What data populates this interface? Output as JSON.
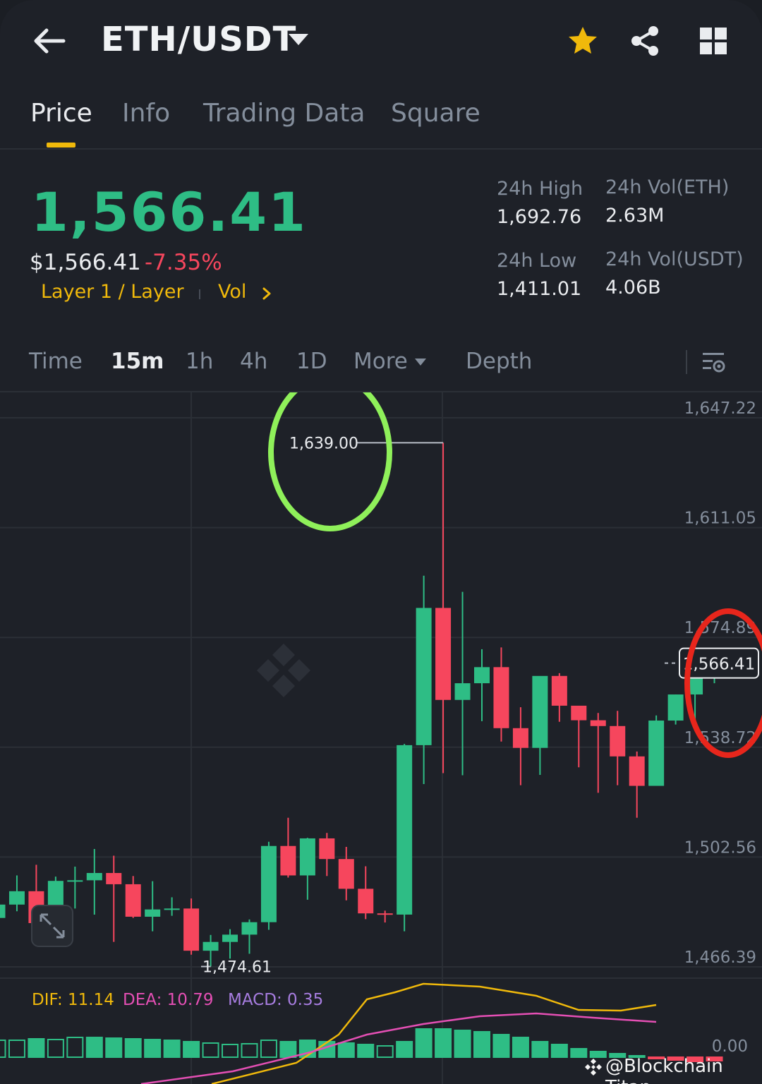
{
  "header": {
    "pair": "ETH/USDT",
    "icons": [
      "back-arrow-icon",
      "caret-down-icon",
      "star-icon",
      "share-icon",
      "grid-icon"
    ],
    "star_color": "#f0b90b"
  },
  "tabs": [
    {
      "label": "Price",
      "active": true
    },
    {
      "label": "Info",
      "active": false
    },
    {
      "label": "Trading Data",
      "active": false
    },
    {
      "label": "Square",
      "active": false
    }
  ],
  "summary": {
    "last_price": "1,566.41",
    "fiat_price": "$1,566.41",
    "change_pct": "-7.35%",
    "tags": [
      "Layer 1 / Layer",
      "Vol"
    ],
    "stats": {
      "high_label": "24h High",
      "high_value": "1,692.76",
      "low_label": "24h Low",
      "low_value": "1,411.01",
      "vol_eth_label": "24h Vol(ETH)",
      "vol_eth_value": "2.63M",
      "vol_usdt_label": "24h Vol(USDT)",
      "vol_usdt_value": "4.06B"
    }
  },
  "intervals": [
    {
      "label": "Time",
      "active": false
    },
    {
      "label": "15m",
      "active": true
    },
    {
      "label": "1h",
      "active": false
    },
    {
      "label": "4h",
      "active": false
    },
    {
      "label": "1D",
      "active": false
    },
    {
      "label": "More",
      "active": false
    },
    {
      "label": "Depth",
      "active": false
    }
  ],
  "colors": {
    "up": "#2ebd85",
    "down": "#f6465d",
    "accent": "#f0b90b",
    "annotation_green": "#8ff05a",
    "annotation_red": "#e8261c"
  },
  "chart_data": {
    "type": "candlestick",
    "y_ticks": [
      "1,647.22",
      "1,611.05",
      "1,574.89",
      "1,538.72",
      "1,502.56",
      "1,466.39"
    ],
    "ylim": [
      1466.39,
      1647.22
    ],
    "high_marker": "1,639.00",
    "low_marker": "1,474.61",
    "last_price_tag": "1,566.41",
    "candles": [
      {
        "o": 1482.5,
        "h": 1490.0,
        "l": 1477.8,
        "c": 1486.9
      },
      {
        "o": 1486.9,
        "h": 1496.5,
        "l": 1484.7,
        "c": 1491.3
      },
      {
        "o": 1491.3,
        "h": 1500.0,
        "l": 1477.1,
        "c": 1480.8
      },
      {
        "o": 1480.8,
        "h": 1496.1,
        "l": 1476.9,
        "c": 1494.7
      },
      {
        "o": 1494.7,
        "h": 1499.4,
        "l": 1485.6,
        "c": 1494.9
      },
      {
        "o": 1494.9,
        "h": 1505.2,
        "l": 1483.6,
        "c": 1497.3
      },
      {
        "o": 1497.3,
        "h": 1503.0,
        "l": 1474.6,
        "c": 1493.6
      },
      {
        "o": 1493.6,
        "h": 1496.3,
        "l": 1482.5,
        "c": 1482.9
      },
      {
        "o": 1482.9,
        "h": 1494.6,
        "l": 1478.1,
        "c": 1485.3
      },
      {
        "o": 1485.3,
        "h": 1489.3,
        "l": 1483.2,
        "c": 1485.6
      },
      {
        "o": 1485.6,
        "h": 1488.9,
        "l": 1470.4,
        "c": 1471.7
      },
      {
        "o": 1471.7,
        "h": 1476.9,
        "l": 1466.5,
        "c": 1474.6
      },
      {
        "o": 1474.6,
        "h": 1478.8,
        "l": 1469.1,
        "c": 1477.0
      },
      {
        "o": 1477.0,
        "h": 1482.0,
        "l": 1470.7,
        "c": 1481.1
      },
      {
        "o": 1481.1,
        "h": 1507.6,
        "l": 1478.6,
        "c": 1506.2
      },
      {
        "o": 1506.2,
        "h": 1515.5,
        "l": 1495.8,
        "c": 1496.5
      },
      {
        "o": 1496.5,
        "h": 1508.9,
        "l": 1488.5,
        "c": 1508.7
      },
      {
        "o": 1508.7,
        "h": 1510.5,
        "l": 1496.3,
        "c": 1501.9
      },
      {
        "o": 1501.9,
        "h": 1505.9,
        "l": 1488.3,
        "c": 1492.1
      },
      {
        "o": 1492.1,
        "h": 1499.5,
        "l": 1482.1,
        "c": 1484.0
      },
      {
        "o": 1484.0,
        "h": 1484.9,
        "l": 1481.0,
        "c": 1483.6
      },
      {
        "o": 1483.6,
        "h": 1539.8,
        "l": 1478.1,
        "c": 1539.4
      },
      {
        "o": 1539.4,
        "h": 1595.2,
        "l": 1526.6,
        "c": 1584.6
      },
      {
        "o": 1584.6,
        "h": 1639.0,
        "l": 1530.2,
        "c": 1554.3
      },
      {
        "o": 1554.3,
        "h": 1589.9,
        "l": 1529.5,
        "c": 1559.8
      },
      {
        "o": 1559.8,
        "h": 1571.0,
        "l": 1547.3,
        "c": 1565.1
      },
      {
        "o": 1565.1,
        "h": 1571.6,
        "l": 1540.6,
        "c": 1545.0
      },
      {
        "o": 1545.0,
        "h": 1551.9,
        "l": 1526.2,
        "c": 1538.5
      },
      {
        "o": 1538.5,
        "h": 1562.0,
        "l": 1529.6,
        "c": 1562.2
      },
      {
        "o": 1562.2,
        "h": 1563.1,
        "l": 1547.1,
        "c": 1552.4
      },
      {
        "o": 1552.4,
        "h": 1552.4,
        "l": 1532.1,
        "c": 1547.6
      },
      {
        "o": 1547.6,
        "h": 1550.0,
        "l": 1523.7,
        "c": 1545.7
      },
      {
        "o": 1545.7,
        "h": 1550.7,
        "l": 1526.2,
        "c": 1535.7
      },
      {
        "o": 1535.7,
        "h": 1537.3,
        "l": 1515.5,
        "c": 1526.0
      },
      {
        "o": 1526.0,
        "h": 1549.2,
        "l": 1526.1,
        "c": 1547.5
      },
      {
        "o": 1547.5,
        "h": 1556.1,
        "l": 1546.2,
        "c": 1556.1
      },
      {
        "o": 1556.1,
        "h": 1568.0,
        "l": 1547.2,
        "c": 1564.8
      },
      {
        "o": 1564.8,
        "h": 1570.8,
        "l": 1559.8,
        "c": 1566.4
      }
    ],
    "macd": {
      "dif_label": "DIF: 11.14",
      "dea_label": "DEA: 10.79",
      "macd_label": "MACD: 0.35",
      "zero_label": "0.00"
    }
  },
  "watermark": "@Blockchain Titan"
}
